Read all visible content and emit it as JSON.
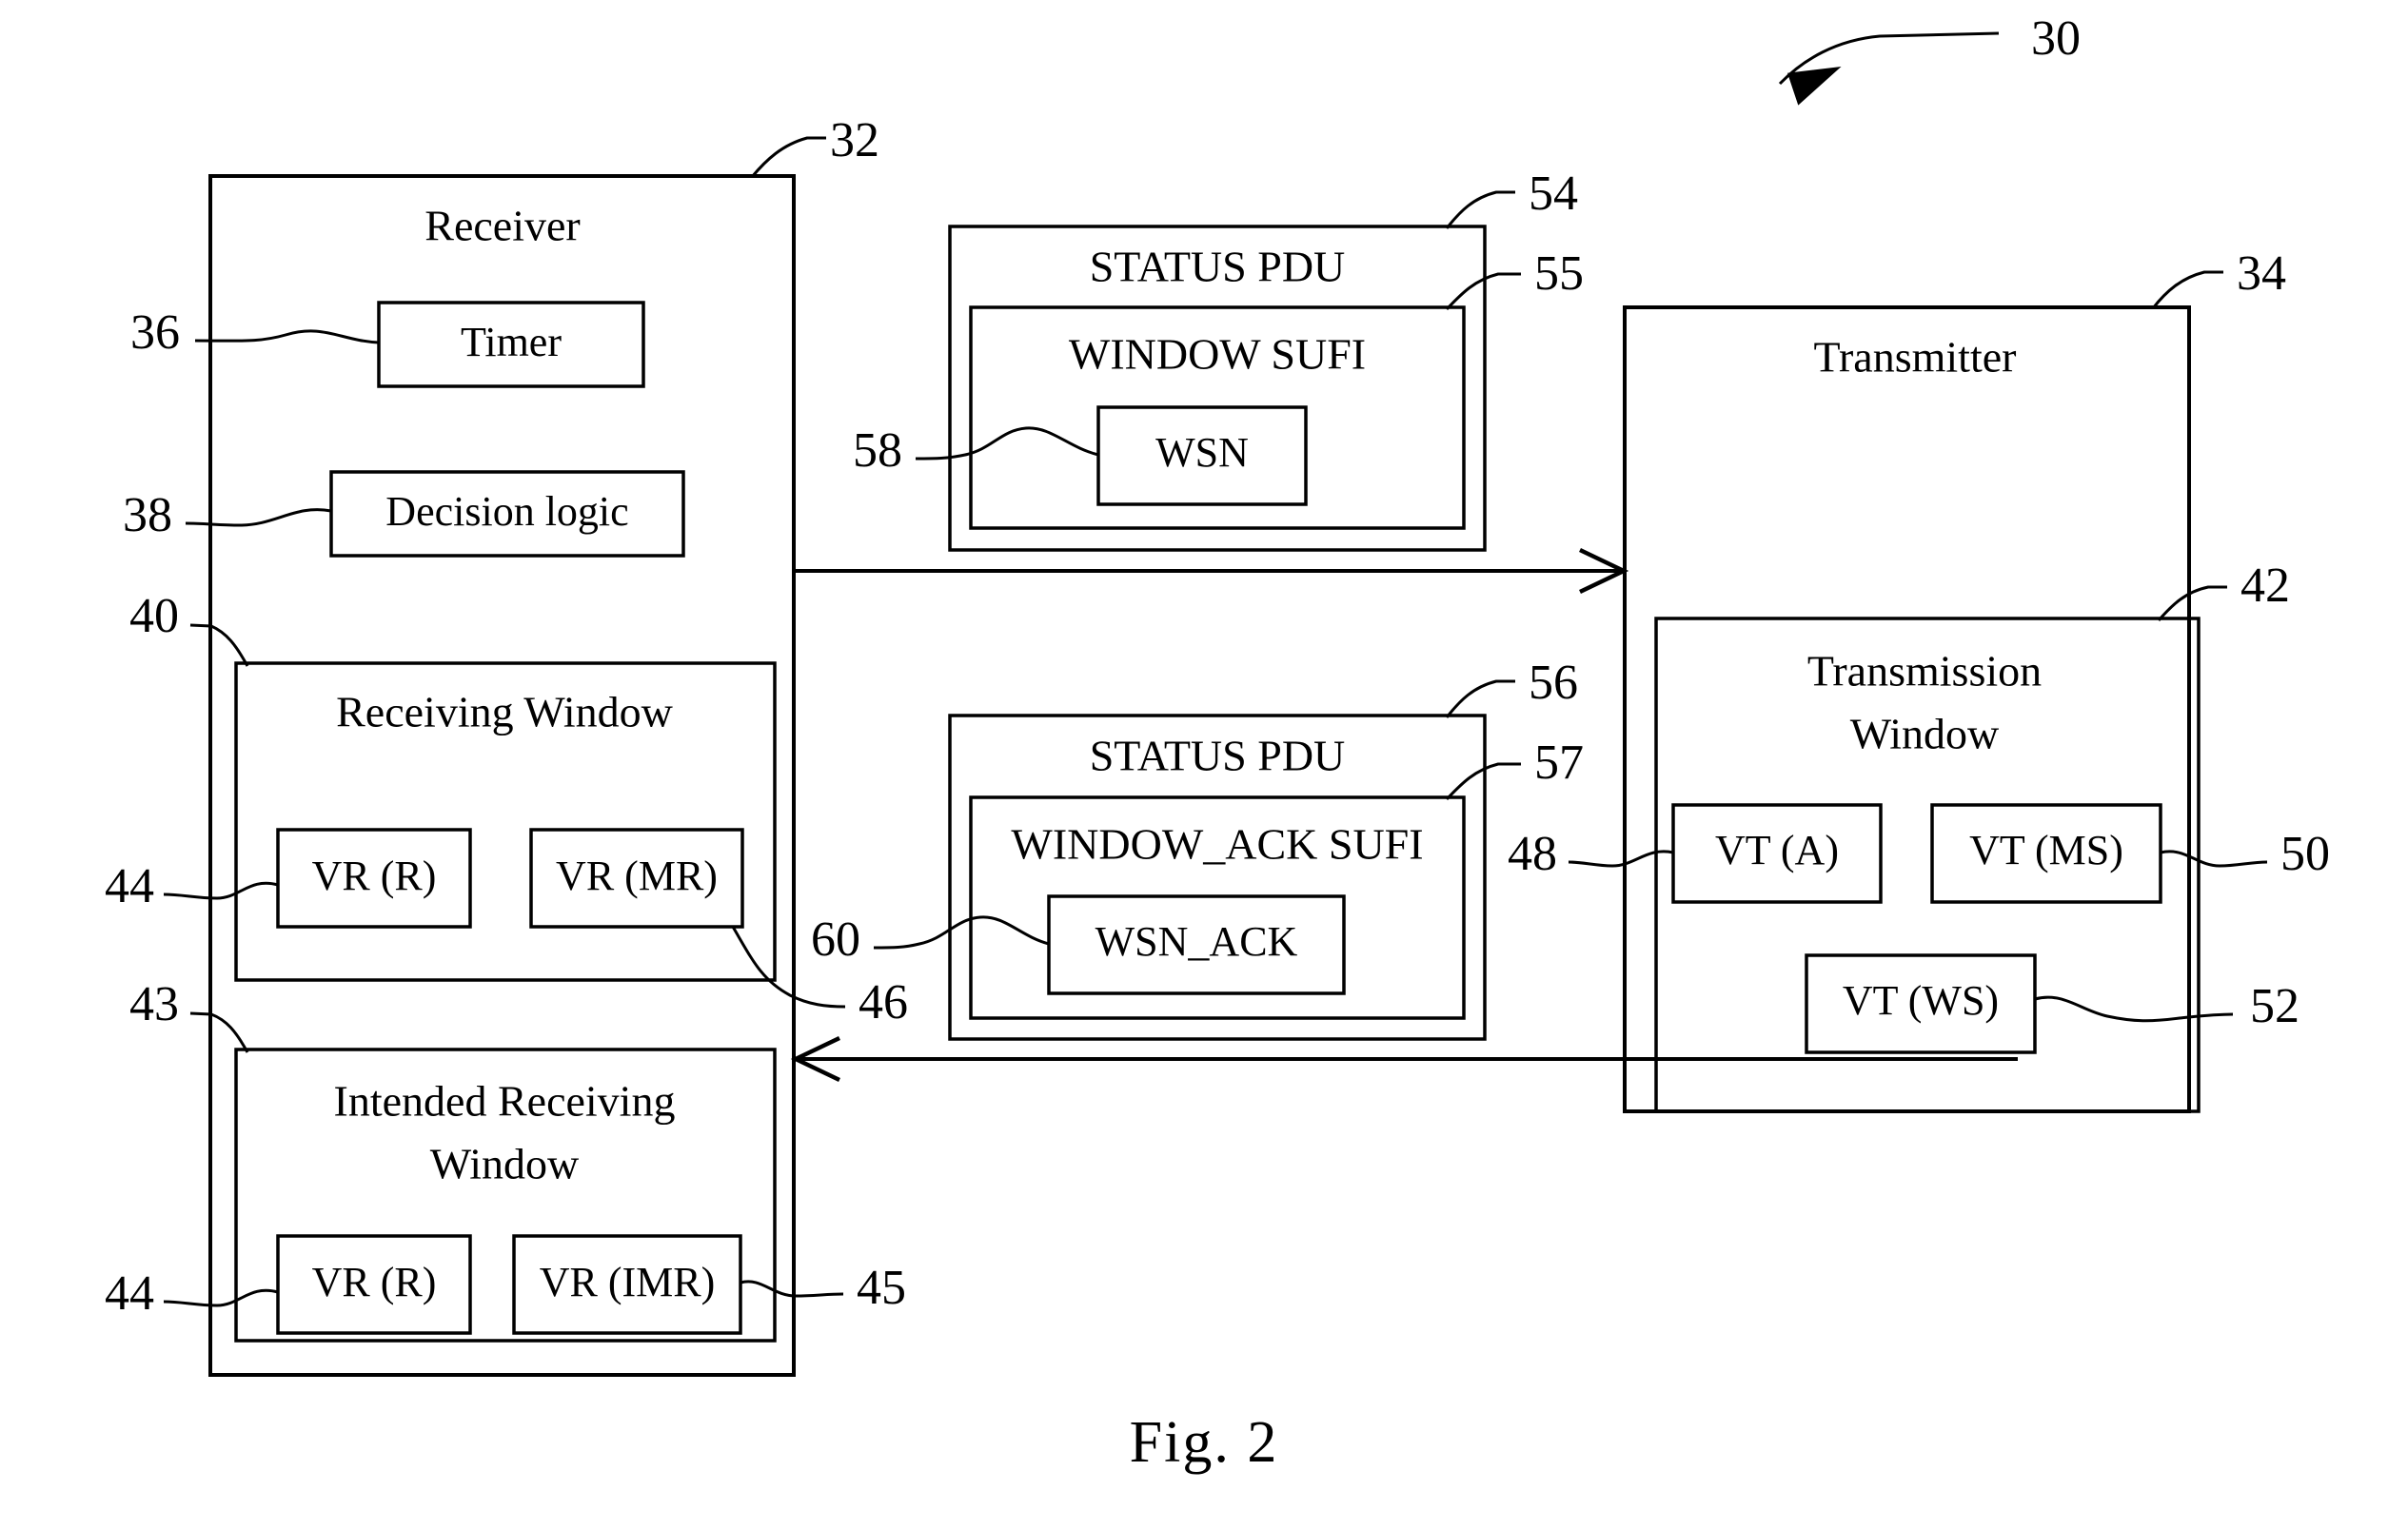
{
  "figure": {
    "caption": "Fig. 2",
    "overall_ref": "30"
  },
  "receiver": {
    "title": "Receiver",
    "ref": "32",
    "timer": {
      "label": "Timer",
      "ref": "36"
    },
    "decision_logic": {
      "label": "Decision logic",
      "ref": "38"
    },
    "receiving_window": {
      "title": "Receiving Window",
      "ref": "40",
      "ref_right": "46",
      "vars": [
        {
          "label": "VR (R)",
          "ref": "44"
        },
        {
          "label": "VR (MR)",
          "ref": ""
        }
      ]
    },
    "intended_receiving_window": {
      "title_line1": "Intended Receiving",
      "title_line2": "Window",
      "ref": "43",
      "ref_right": "45",
      "vars": [
        {
          "label": "VR (R)",
          "ref": "44"
        },
        {
          "label": "VR (IMR)",
          "ref": ""
        }
      ]
    }
  },
  "status_pdu_window": {
    "title": "STATUS PDU",
    "ref": "54",
    "sufi": {
      "title": "WINDOW SUFI",
      "ref": "55",
      "field": {
        "label": "WSN",
        "ref": "58"
      }
    }
  },
  "status_pdu_window_ack": {
    "title": "STATUS PDU",
    "ref": "56",
    "sufi": {
      "title": "WINDOW_ACK SUFI",
      "ref": "57",
      "field": {
        "label": "WSN_ACK",
        "ref": "60"
      }
    }
  },
  "transmitter": {
    "title": "Transmitter",
    "ref": "34",
    "transmission_window": {
      "title_line1": "Transmission",
      "title_line2": "Window",
      "ref": "42",
      "vars": [
        {
          "label": "VT (A)",
          "ref": "48"
        },
        {
          "label": "VT (MS)",
          "ref": "50"
        },
        {
          "label": "VT (WS)",
          "ref": "52"
        }
      ]
    }
  },
  "colors": {
    "stroke": "#000000",
    "background": "#ffffff"
  }
}
